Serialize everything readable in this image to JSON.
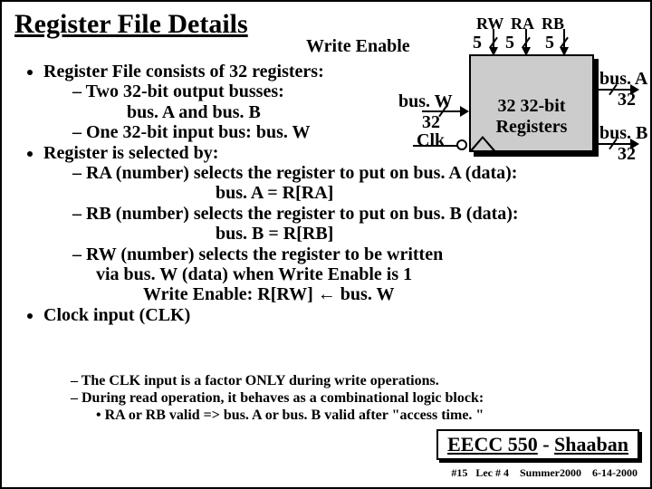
{
  "title": "Register File Details",
  "writeEnable": "Write Enable",
  "signals": {
    "rw": "RW",
    "ra": "RA",
    "rb": "RB",
    "selBits": "5"
  },
  "rfbox": {
    "l1": "32 32-bit",
    "l2": "Registers"
  },
  "buses": {
    "busW_name": "bus. W",
    "busW_bits": "32",
    "clk_name": "Clk",
    "busA_name": "bus. A",
    "busA_bits": "32",
    "busB_name": "bus. B",
    "busB_bits": "32"
  },
  "b": {
    "l1": "Register File consists of 32 registers:",
    "l2": "Two 32-bit output busses:",
    "l3": "bus. A  and  bus. B",
    "l4": "One 32-bit input bus: bus. W",
    "l5": "Register is selected by:",
    "l6": "RA (number) selects the register to put on bus. A (data):",
    "l7": "bus. A = R[RA]",
    "l8": "RB (number) selects the register to put on bus. B (data):",
    "l9": "bus. B = R[RB]",
    "l10": "RW (number) selects the register to be  written",
    "l11": "via bus. W (data) when Write Enable is 1",
    "l12": "Write Enable:   R[RW] ←  bus. W",
    "l13": "Clock input (CLK)"
  },
  "f": {
    "l1": "The CLK input is a factor ONLY during write operations.",
    "l2": "During read operation, it behaves as a combinational logic block:",
    "l3": "RA or RB valid  =>  bus. A or  bus. B valid after \"access time. \""
  },
  "course": {
    "code": "EECC 550",
    "sep": " - ",
    "prof": "Shaaban"
  },
  "footer": {
    "slide": "#15",
    "lec": "Lec # 4",
    "term": "Summer2000",
    "date": "6-14-2000"
  }
}
